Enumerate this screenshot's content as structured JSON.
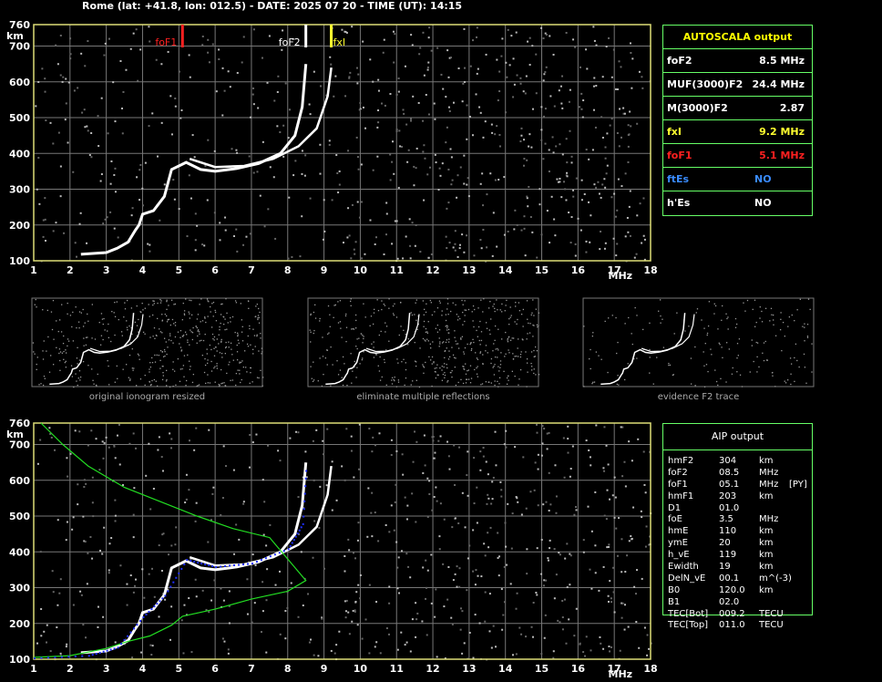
{
  "header": "Rome (lat: +41.8, lon: 012.5) - DATE: 2025 07 20 - TIME (UT): 14:15",
  "colors": {
    "grid": "#777777",
    "frame": "#dddd77",
    "trace": "#ffffff",
    "foF1": "#ff2020",
    "fxI": "#ffff30",
    "ftEs": "#3a8cff",
    "profile": "#22dd22",
    "fit": "#2030ff",
    "table_border": "#66ff66"
  },
  "chart_data": [
    {
      "type": "scatter",
      "title": "",
      "xlabel": "MHz",
      "ylabel": "km",
      "xlim": [
        1,
        18
      ],
      "ylim": [
        100,
        760
      ],
      "x_ticks": [
        1,
        2,
        3,
        4,
        5,
        6,
        7,
        8,
        9,
        10,
        11,
        12,
        13,
        14,
        15,
        16,
        17,
        18
      ],
      "y_ticks": [
        100,
        200,
        300,
        400,
        500,
        600,
        700,
        760
      ],
      "markers": [
        {
          "name": "foF1",
          "x": 5.1
        },
        {
          "name": "foF2",
          "x": 8.5
        },
        {
          "name": "fxI",
          "x": 9.2
        }
      ],
      "o_trace": [
        [
          2.3,
          118
        ],
        [
          3.0,
          123
        ],
        [
          3.3,
          135
        ],
        [
          3.6,
          152
        ],
        [
          3.8,
          185
        ],
        [
          3.9,
          200
        ],
        [
          4.0,
          230
        ],
        [
          4.3,
          240
        ],
        [
          4.6,
          280
        ],
        [
          4.8,
          355
        ],
        [
          5.2,
          375
        ],
        [
          5.6,
          355
        ],
        [
          6.0,
          350
        ],
        [
          6.6,
          358
        ],
        [
          7.2,
          372
        ],
        [
          7.8,
          400
        ],
        [
          8.2,
          450
        ],
        [
          8.4,
          530
        ],
        [
          8.5,
          650
        ]
      ],
      "x_trace": [
        [
          5.3,
          385
        ],
        [
          6.0,
          362
        ],
        [
          6.8,
          365
        ],
        [
          7.6,
          385
        ],
        [
          8.3,
          420
        ],
        [
          8.8,
          470
        ],
        [
          9.1,
          560
        ],
        [
          9.2,
          640
        ]
      ]
    },
    {
      "type": "scatter",
      "title": "",
      "xlabel": "MHz",
      "ylabel": "km",
      "xlim": [
        1,
        18
      ],
      "ylim": [
        100,
        760
      ],
      "x_ticks": [
        1,
        2,
        3,
        4,
        5,
        6,
        7,
        8,
        9,
        10,
        11,
        12,
        13,
        14,
        15,
        16,
        17,
        18
      ],
      "y_ticks": [
        100,
        200,
        300,
        400,
        500,
        600,
        700,
        760
      ],
      "profile": [
        [
          1.2,
          760
        ],
        [
          1.8,
          700
        ],
        [
          2.5,
          640
        ],
        [
          3.5,
          580
        ],
        [
          4.5,
          540
        ],
        [
          5.5,
          500
        ],
        [
          6.5,
          465
        ],
        [
          7.5,
          440
        ],
        [
          8.5,
          320
        ],
        [
          8.0,
          290
        ],
        [
          7.0,
          268
        ],
        [
          6.0,
          240
        ],
        [
          5.1,
          220
        ],
        [
          4.8,
          195
        ],
        [
          4.2,
          165
        ],
        [
          3.6,
          150
        ],
        [
          3.0,
          130
        ],
        [
          2.0,
          110
        ],
        [
          1.0,
          105
        ]
      ],
      "fit": [
        [
          1.0,
          105
        ],
        [
          2.5,
          112
        ],
        [
          3.3,
          135
        ],
        [
          4.0,
          220
        ],
        [
          4.6,
          280
        ],
        [
          5.2,
          380
        ],
        [
          6.0,
          360
        ],
        [
          7.0,
          370
        ],
        [
          8.0,
          410
        ],
        [
          8.4,
          480
        ],
        [
          8.5,
          650
        ]
      ]
    }
  ],
  "thumbnails": [
    {
      "caption": "original ionogram resized"
    },
    {
      "caption": "eliminate multiple reflections"
    },
    {
      "caption": "evidence F2 trace"
    }
  ],
  "autoscala": {
    "title": "AUTOSCALA output",
    "rows": [
      {
        "name": "foF2",
        "value": "8.5 MHz",
        "color": "#ffffff"
      },
      {
        "name": "MUF(3000)F2",
        "value": "24.4 MHz",
        "color": "#ffffff"
      },
      {
        "name": "M(3000)F2",
        "value": "2.87",
        "color": "#ffffff"
      },
      {
        "name": "fxI",
        "value": "9.2 MHz",
        "color": "#ffff30"
      },
      {
        "name": "foF1",
        "value": "5.1 MHz",
        "color": "#ff2020"
      },
      {
        "name": "ftEs",
        "value": "NO",
        "color": "#3a8cff"
      },
      {
        "name": "h'Es",
        "value": "NO",
        "color": "#ffffff"
      }
    ]
  },
  "aip": {
    "title": "AIP output",
    "rows": [
      [
        "hmF2",
        "304",
        "km",
        ""
      ],
      [
        "foF2",
        "08.5",
        "MHz",
        ""
      ],
      [
        "foF1",
        "05.1",
        "MHz",
        "[PY]"
      ],
      [
        "hmF1",
        "203",
        "km",
        ""
      ],
      [
        "D1",
        "01.0",
        "",
        ""
      ],
      [
        "foE",
        "3.5",
        "MHz",
        ""
      ],
      [
        "hmE",
        "110",
        "km",
        ""
      ],
      [
        "ymE",
        "20",
        "km",
        ""
      ],
      [
        "h_vE",
        "119",
        "km",
        ""
      ],
      [
        "Ewidth",
        "19",
        "km",
        ""
      ],
      [
        "DelN_vE",
        "00.1",
        "m^(-3)",
        ""
      ],
      [
        "B0",
        "120.0",
        "km",
        ""
      ],
      [
        "B1",
        "02.0",
        "",
        ""
      ],
      [
        "TEC[Bot]",
        "009.2",
        "TECU",
        ""
      ],
      [
        "TEC[Top]",
        "011.0",
        "TECU",
        ""
      ]
    ]
  }
}
